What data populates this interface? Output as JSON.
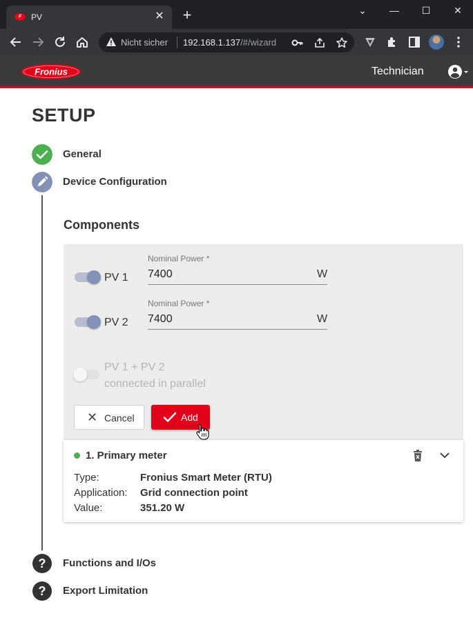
{
  "browser": {
    "tab_title": "PV",
    "tab_close": "✕",
    "new_tab": "+",
    "window_controls": {
      "minimize": "—",
      "maximize": "☐",
      "close": "✕",
      "tabs_menu": "⌄"
    },
    "security_label": "Nicht sicher",
    "url_host": "192.168.1.137",
    "url_path": "/#/wizard",
    "icons": [
      "back-icon",
      "forward-icon",
      "reload-icon",
      "home-icon",
      "warning-icon",
      "key-icon",
      "share-icon",
      "star-icon",
      "vivaldi-icon",
      "puzzle-icon",
      "sidebar-icon",
      "profile-avatar",
      "kebab-menu-icon"
    ]
  },
  "app": {
    "brand": "Fronius",
    "brand_color": "#e3001b",
    "user": "Technician"
  },
  "page": {
    "title": "SETUP",
    "steps": [
      {
        "label": "General",
        "status": "done",
        "icon": "check-icon"
      },
      {
        "label": "Device Configuration",
        "status": "active",
        "icon": "pencil-icon"
      },
      {
        "label": "Functions and I/Os",
        "status": "pending",
        "icon": "question-icon"
      },
      {
        "label": "Export Limitation",
        "status": "pending",
        "icon": "question-icon"
      }
    ],
    "components_title": "Components",
    "form": {
      "pv1": {
        "label": "PV 1",
        "enabled": true,
        "field_label": "Nominal Power *",
        "value": "7400",
        "unit": "W"
      },
      "pv2": {
        "label": "PV 2",
        "enabled": true,
        "field_label": "Nominal Power *",
        "value": "7400",
        "unit": "W"
      },
      "parallel": {
        "line1": "PV 1 + PV 2",
        "line2": "connected in parallel",
        "enabled": false
      },
      "cancel_label": "Cancel",
      "add_label": "Add"
    },
    "meter": {
      "title": "1. Primary meter",
      "status_color": "#4caf50",
      "rows": [
        {
          "key": "Type:",
          "value": "Fronius Smart Meter (RTU)"
        },
        {
          "key": "Application:",
          "value": "Grid connection point"
        },
        {
          "key": "Value:",
          "value": "351.20 W"
        }
      ]
    }
  }
}
